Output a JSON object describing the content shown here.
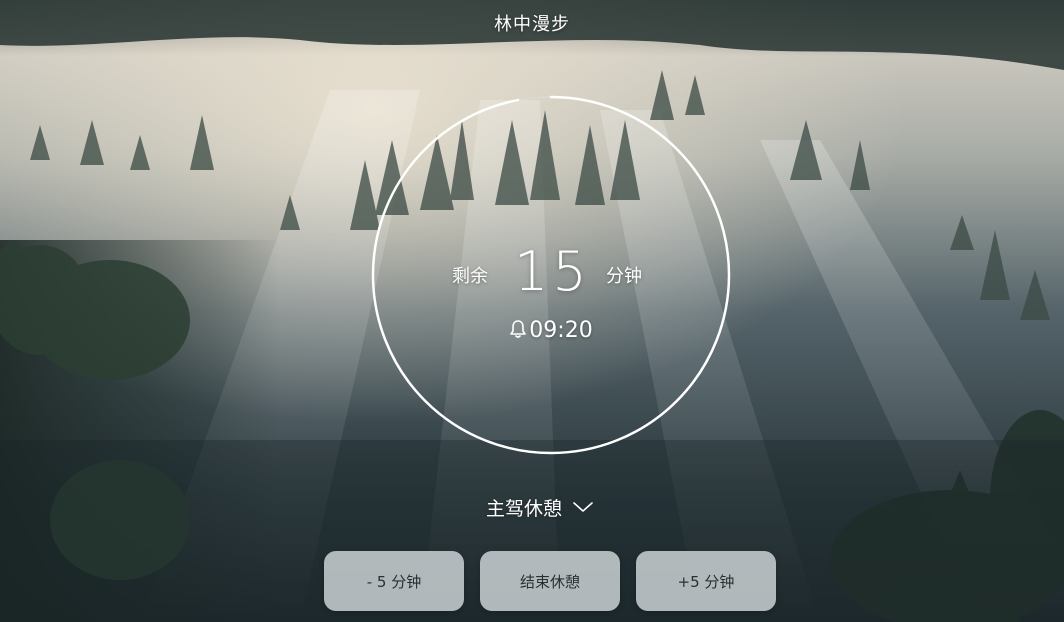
{
  "header": {
    "title": "林中漫步"
  },
  "timer": {
    "remaining_label": "剩余",
    "remaining_value": "15",
    "remaining_unit": "分钟",
    "alarm_time": "09:20",
    "alarm_icon": "bell-icon",
    "progress_fraction": 0.97
  },
  "mode": {
    "label": "主驾休憩",
    "icon": "chevron-down-icon"
  },
  "buttons": {
    "minus": "- 5 分钟",
    "end": "结束休憩",
    "plus": "+5 分钟"
  },
  "colors": {
    "button_bg": "#d2d8da",
    "button_text": "#2a2f33",
    "text": "#ffffff"
  }
}
